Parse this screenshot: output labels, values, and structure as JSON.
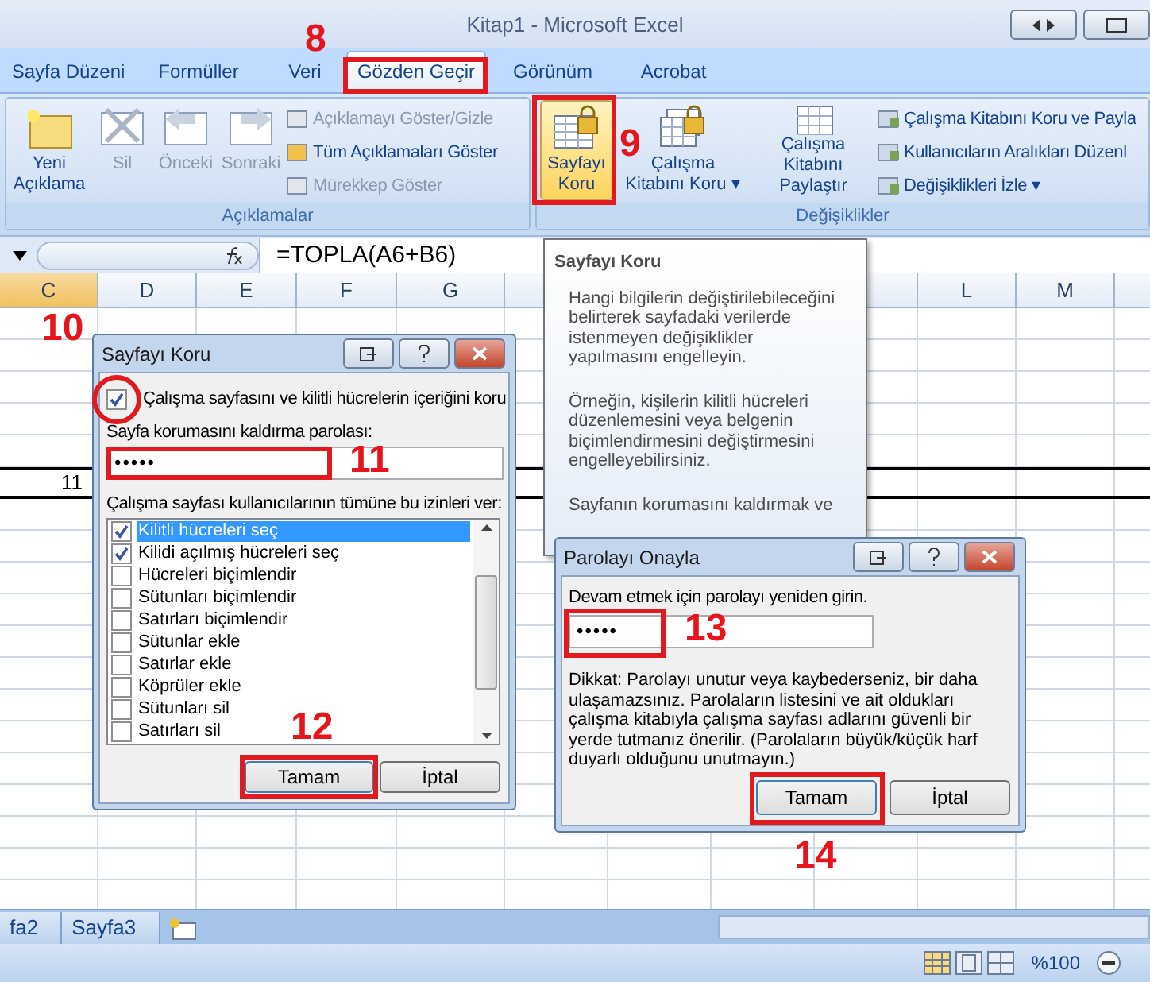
{
  "window": {
    "title": "Kitap1 - Microsoft Excel"
  },
  "tabs": [
    {
      "label": "Sayfa Düzeni",
      "selected": false
    },
    {
      "label": "Formüller",
      "selected": false
    },
    {
      "label": "Veri",
      "selected": false
    },
    {
      "label": "Gözden Geçir",
      "selected": true
    },
    {
      "label": "Görünüm",
      "selected": false
    },
    {
      "label": "Acrobat",
      "selected": false
    }
  ],
  "ribbon": {
    "groups": [
      {
        "title": "Açıklamalar",
        "large_buttons": [
          {
            "label": "Yeni Açıklama",
            "disabled": false,
            "selected": false,
            "kind": "note"
          },
          {
            "label": "Sil",
            "disabled": true,
            "selected": false,
            "kind": "delete"
          },
          {
            "label": "Önceki",
            "disabled": true,
            "selected": false,
            "kind": "prev"
          },
          {
            "label": "Sonraki",
            "disabled": true,
            "selected": false,
            "kind": "next"
          }
        ],
        "small_buttons": [
          {
            "label": "Açıklamayı Göster/Gizle",
            "disabled": true
          },
          {
            "label": "Tüm Açıklamaları Göster",
            "disabled": false
          },
          {
            "label": "Mürekkep Göster",
            "disabled": true
          }
        ]
      },
      {
        "title": "Değişiklikler",
        "large_buttons": [
          {
            "label": "Sayfayı Koru",
            "disabled": false,
            "selected": true,
            "kind": "sheet-lock"
          },
          {
            "label": "Çalışma Kitabını Koru ▾",
            "disabled": false,
            "selected": false,
            "kind": "book-lock"
          },
          {
            "label": "Çalışma Kitabını Paylaştır",
            "disabled": false,
            "selected": false,
            "kind": "share"
          }
        ],
        "small_buttons": [
          {
            "label": "Çalışma Kitabını Koru ve Payla",
            "disabled": false
          },
          {
            "label": "Kullanıcıların Aralıkları Düzenl",
            "disabled": false
          },
          {
            "label": "Değişiklikleri İzle ▾",
            "disabled": false
          }
        ]
      }
    ]
  },
  "formula_bar": {
    "formula": "=TOPLA(A6+B6)"
  },
  "columns": [
    "C",
    "D",
    "E",
    "F",
    "G",
    "L",
    "M"
  ],
  "cell_value": "11",
  "tooltip": {
    "title": "Sayfayı Koru",
    "paragraphs": [
      "Hangi bilgilerin değiştirilebileceğini belirterek sayfadaki verilerde istenmeyen değişiklikler yapılmasını engelleyin.",
      "Örneğin, kişilerin kilitli hücreleri düzenlemesini veya belgenin biçimlendirmesini değiştirmesini engelleyebilirsiniz.",
      "Sayfanın korumasını kaldırmak ve"
    ]
  },
  "protect_dialog": {
    "title": "Sayfayı Koru",
    "protect_checkbox": {
      "label": "Çalışma sayfasını ve kilitli hücrelerin içeriğini koru",
      "checked": true
    },
    "password_label": "Sayfa korumasını kaldırma parolası:",
    "password": "•••••",
    "permissions_label": "Çalışma sayfası kullanıcılarının tümüne bu izinleri ver:",
    "permissions": [
      {
        "label": "Kilitli hücreleri seç",
        "checked": true,
        "selected": true
      },
      {
        "label": "Kilidi açılmış hücreleri seç",
        "checked": true,
        "selected": false
      },
      {
        "label": "Hücreleri biçimlendir",
        "checked": false,
        "selected": false
      },
      {
        "label": "Sütunları biçimlendir",
        "checked": false,
        "selected": false
      },
      {
        "label": "Satırları biçimlendir",
        "checked": false,
        "selected": false
      },
      {
        "label": "Sütunlar ekle",
        "checked": false,
        "selected": false
      },
      {
        "label": "Satırlar ekle",
        "checked": false,
        "selected": false
      },
      {
        "label": "Köprüler ekle",
        "checked": false,
        "selected": false
      },
      {
        "label": "Sütunları sil",
        "checked": false,
        "selected": false
      },
      {
        "label": "Satırları sil",
        "checked": false,
        "selected": false
      }
    ],
    "buttons": [
      "Tamam",
      "İptal"
    ]
  },
  "confirm_dialog": {
    "title": "Parolayı Onayla",
    "prompt": "Devam etmek için parolayı yeniden girin.",
    "password": "•••••",
    "warning": "Dikkat: Parolayı unutur veya kaybederseniz, bir daha ulaşamazsınız. Parolaların listesini ve ait oldukları çalışma kitabıyla çalışma sayfası adlarını güvenli bir yerde tutmanız önerilir. (Parolaların büyük/küçük harf duyarlı olduğunu unutmayın.)",
    "buttons": [
      "Tamam",
      "İptal"
    ]
  },
  "sheet_tabs": [
    "fa2",
    "Sayfa3"
  ],
  "status_bar": {
    "zoom": "%100"
  },
  "annotations": [
    "8",
    "9",
    "10",
    "11",
    "12",
    "13",
    "14"
  ]
}
